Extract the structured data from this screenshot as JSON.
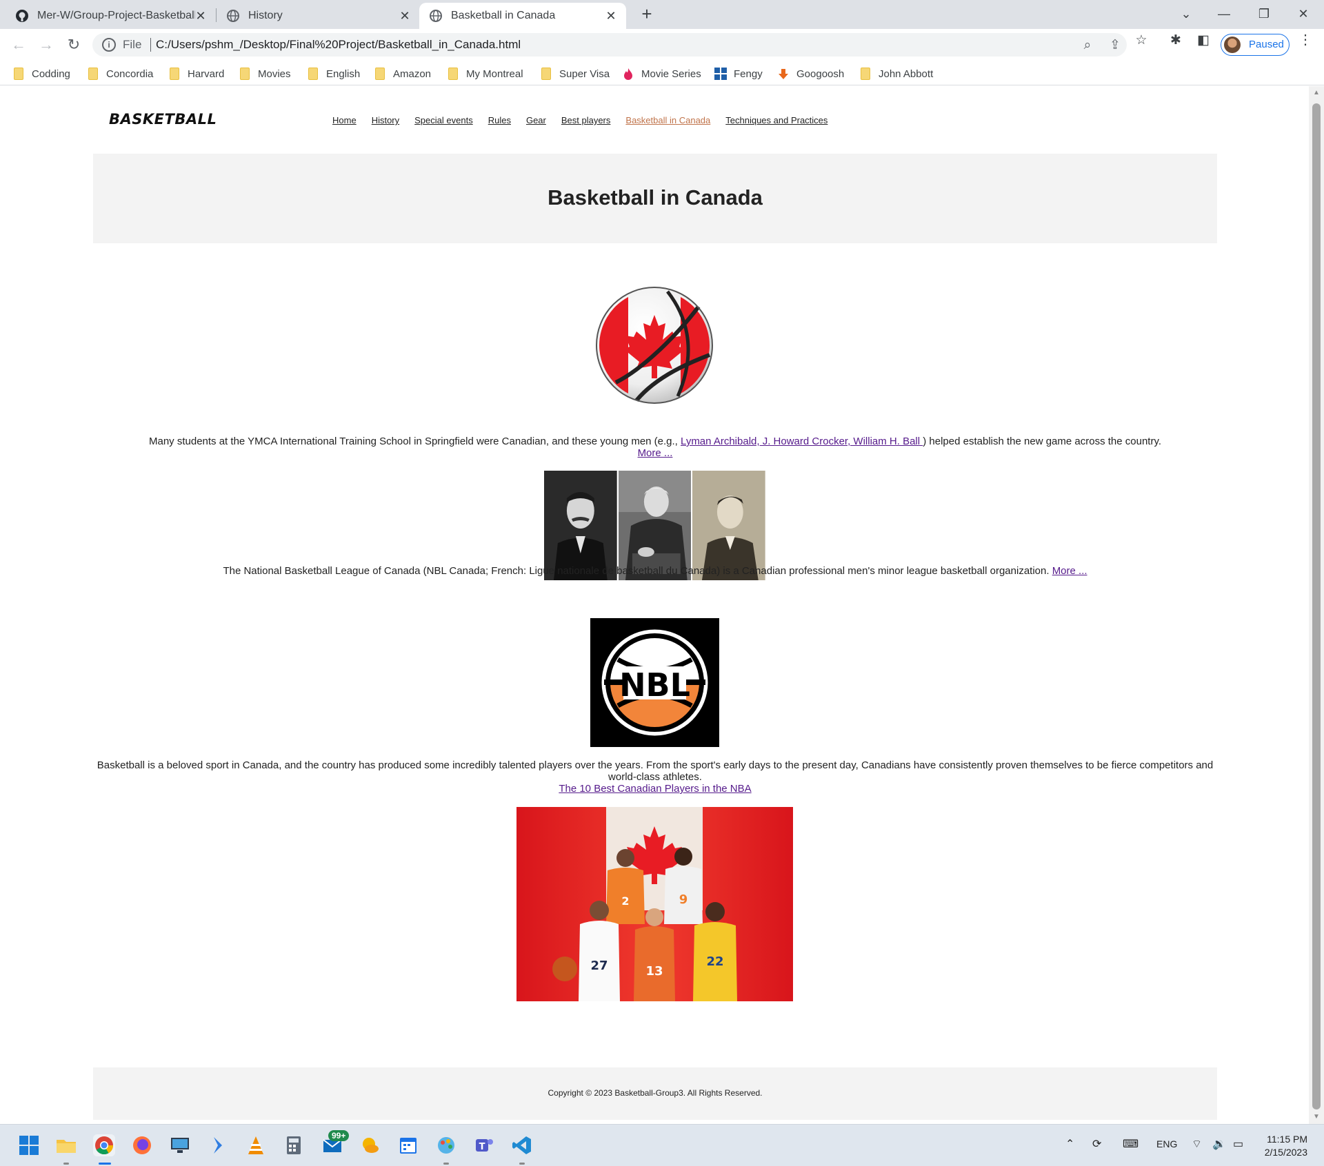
{
  "browser": {
    "tabs": [
      {
        "title": "Mer-W/Group-Project-Basketball",
        "icon": "github-icon"
      },
      {
        "title": "History",
        "icon": "globe-icon"
      },
      {
        "title": "Basketball in Canada",
        "icon": "globe-icon",
        "active": true
      }
    ],
    "address": {
      "scheme": "File",
      "url": "C:/Users/pshm_/Desktop/Final%20Project/Basketball_in_Canada.html"
    },
    "profile_label": "Paused",
    "bookmarks": [
      "Codding",
      "Concordia",
      "Harvard",
      "Movies",
      "English",
      "Amazon",
      "My Montreal",
      "Super Visa",
      "Movie Series",
      "Fengy",
      "Googoosh",
      "John Abbott"
    ]
  },
  "site": {
    "logo": "BASKETBALL",
    "nav": [
      "Home",
      "History",
      "Special events",
      "Rules",
      "Gear",
      "Best players",
      "Basketball in Canada",
      "Techniques and Practices"
    ],
    "current_nav": "Basketball in Canada",
    "title": "Basketball in Canada",
    "para1": {
      "before": "Many students at the YMCA International Training School in Springfield were Canadian, and these young men (e.g., ",
      "link": "Lyman Archibald, J. Howard Crocker, William H. Ball ",
      "after": ") helped establish the new game across the country.",
      "more": "More ..."
    },
    "para2": {
      "text": "The National Basketball League of Canada (NBL Canada; French: Ligue nationale de basketball du Canada) is a Canadian professional men's minor league basketball organization. ",
      "more": "More ..."
    },
    "nbl_logo_text": "NBL",
    "para3": {
      "text": "Basketball is a beloved sport in Canada, and the country has produced some incredibly talented players over the years. From the sport's early days to the present day, Canadians have consistently proven themselves to be fierce competitors and world-class athletes.",
      "link": "The 10 Best Canadian Players in the NBA"
    },
    "jersey_numbers": [
      "2",
      "9",
      "27",
      "13",
      "22"
    ],
    "footer": "Copyright © 2023 Basketball-Group3. All Rights Reserved."
  },
  "taskbar": {
    "mail_badge": "99+",
    "lang": "ENG",
    "time": "11:15 PM",
    "date": "2/15/2023"
  },
  "colors": {
    "accent": "#1a73e8",
    "nav_current": "#c0734a",
    "visited_link": "#551a8b",
    "canada_red": "#e81c24"
  }
}
